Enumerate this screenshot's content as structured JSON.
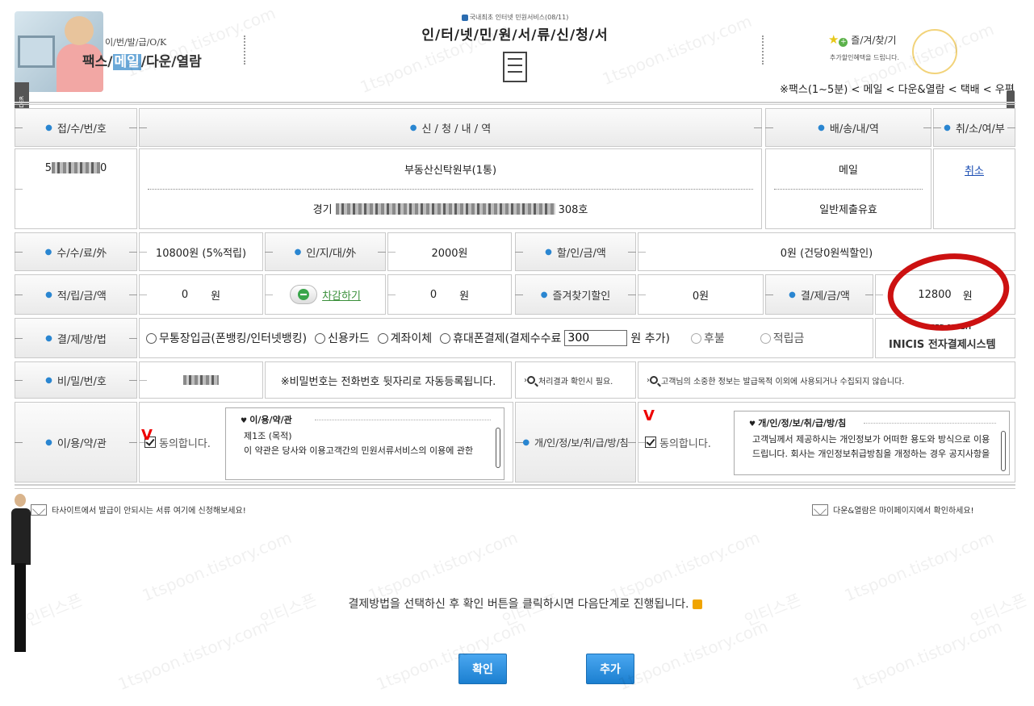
{
  "header": {
    "services_sub": "이/번/발/급/O/K",
    "services_main_pre": "팩스/",
    "services_main_hl": "메일",
    "services_main_post": "/다운/열람",
    "order_tab": "ORDER",
    "top_note": "국내최초 인터넷 민원서비스(08/11)",
    "form_title": "인/터/넷/민/원/서/류/신/청/서",
    "favorite_label": "즐/겨/찾/기",
    "favorite_sub": "추가할인혜택을 드립니다.",
    "shipping_note": "※팩스(1~5분) < 메일 < 다운&열람 < 택배 < 우편"
  },
  "table": {
    "h_receipt_no": "접/수/번/호",
    "h_details": "신 / 청 / 내 / 역",
    "h_delivery": "배/송/내/역",
    "h_cancel": "취/소/여/부",
    "receipt_no_pre": "5",
    "receipt_no_post": "0",
    "doc_name": "부동산신탁원부(1통)",
    "address_pre": "경기",
    "address_post": "308호",
    "delivery_method": "메일",
    "delivery_type": "일반제출유효",
    "cancel_link": "취소",
    "h_fee": "수/수/료/外",
    "fee_value": "10800원 (5%적립)",
    "h_stamp": "인/지/대/外",
    "stamp_value": "2000원",
    "h_discount": "할/인/금/액",
    "discount_value": "0원 (건당0원씩할인)",
    "h_points": "적/립/금/액",
    "points_value": "0",
    "points_unit": "원",
    "deduct_label": "차감하기",
    "deduct_value": "0",
    "deduct_unit": "원",
    "h_fav_discount": "즐겨찾기할인",
    "fav_discount_value": "0원",
    "h_payment_amount": "결/제/금/액",
    "payment_amount": "12800",
    "payment_unit": "원",
    "h_payment_method": "결/제/방/법",
    "pay_opt_bank": "무통장입금(폰뱅킹/인터넷뱅킹)",
    "pay_opt_card": "신용카드",
    "pay_opt_transfer": "계좌이체",
    "pay_opt_phone": "휴대폰결제(결제수수료",
    "phone_fee_value": "300",
    "pay_opt_phone_suffix": "원 추가)",
    "pay_opt_later": "후불",
    "pay_opt_points": "적립금",
    "inicis_seed": "SEED 128BIT",
    "inicis_label": "INICIS 전자결제시스템",
    "h_password": "비/밀/번/호",
    "password_note": "※비밀번호는 전화번호 뒷자리로 자동등록됩니다.",
    "process_note": "처리결과 확인시 필요.",
    "privacy_note": "고객님의 소중한 정보는 발급목적 이외에 사용되거나 수집되지 않습니다.",
    "h_terms": "이/용/약/관",
    "agree_label": "동의합니다.",
    "terms_title": "이/용/약/관",
    "terms_line1": "제1조 (목적)",
    "terms_line2": "이 약관은 당사와 이용고객간의 민원서류서비스의 이용에 관한",
    "h_privacy": "개/인/정/보/취/급/방/침",
    "privacy_title": "개/인/정/보/취/급/방/침",
    "privacy_line1": "고객님께서 제공하시는 개인정보가 어떠한 용도와 방식으로 이용",
    "privacy_line2": "드립니다. 회사는 개인정보취급방침을 개정하는 경우 공지사항을",
    "mark_v": "V"
  },
  "footer": {
    "left_note": "타사이트에서 발급이 안되시는 서류 여기에 신청해보세요!",
    "right_note": "다운&열람은 마이페이지에서 확인하세요!",
    "guide_text": "결제방법을 선택하신 후 확인 버튼을 클릭하시면 다음단계로 진행됩니다.",
    "confirm_button": "확인",
    "add_button": "추가"
  },
  "watermarks": [
    "1tspoon.tistory.com",
    "인티스픈"
  ],
  "colors": {
    "accent_blue": "#2a86d1",
    "button_blue": "#1b7fd0",
    "link_blue": "#1a4db3",
    "annotation_red": "#cc1111",
    "header_highlight": "#6aa8d8"
  }
}
